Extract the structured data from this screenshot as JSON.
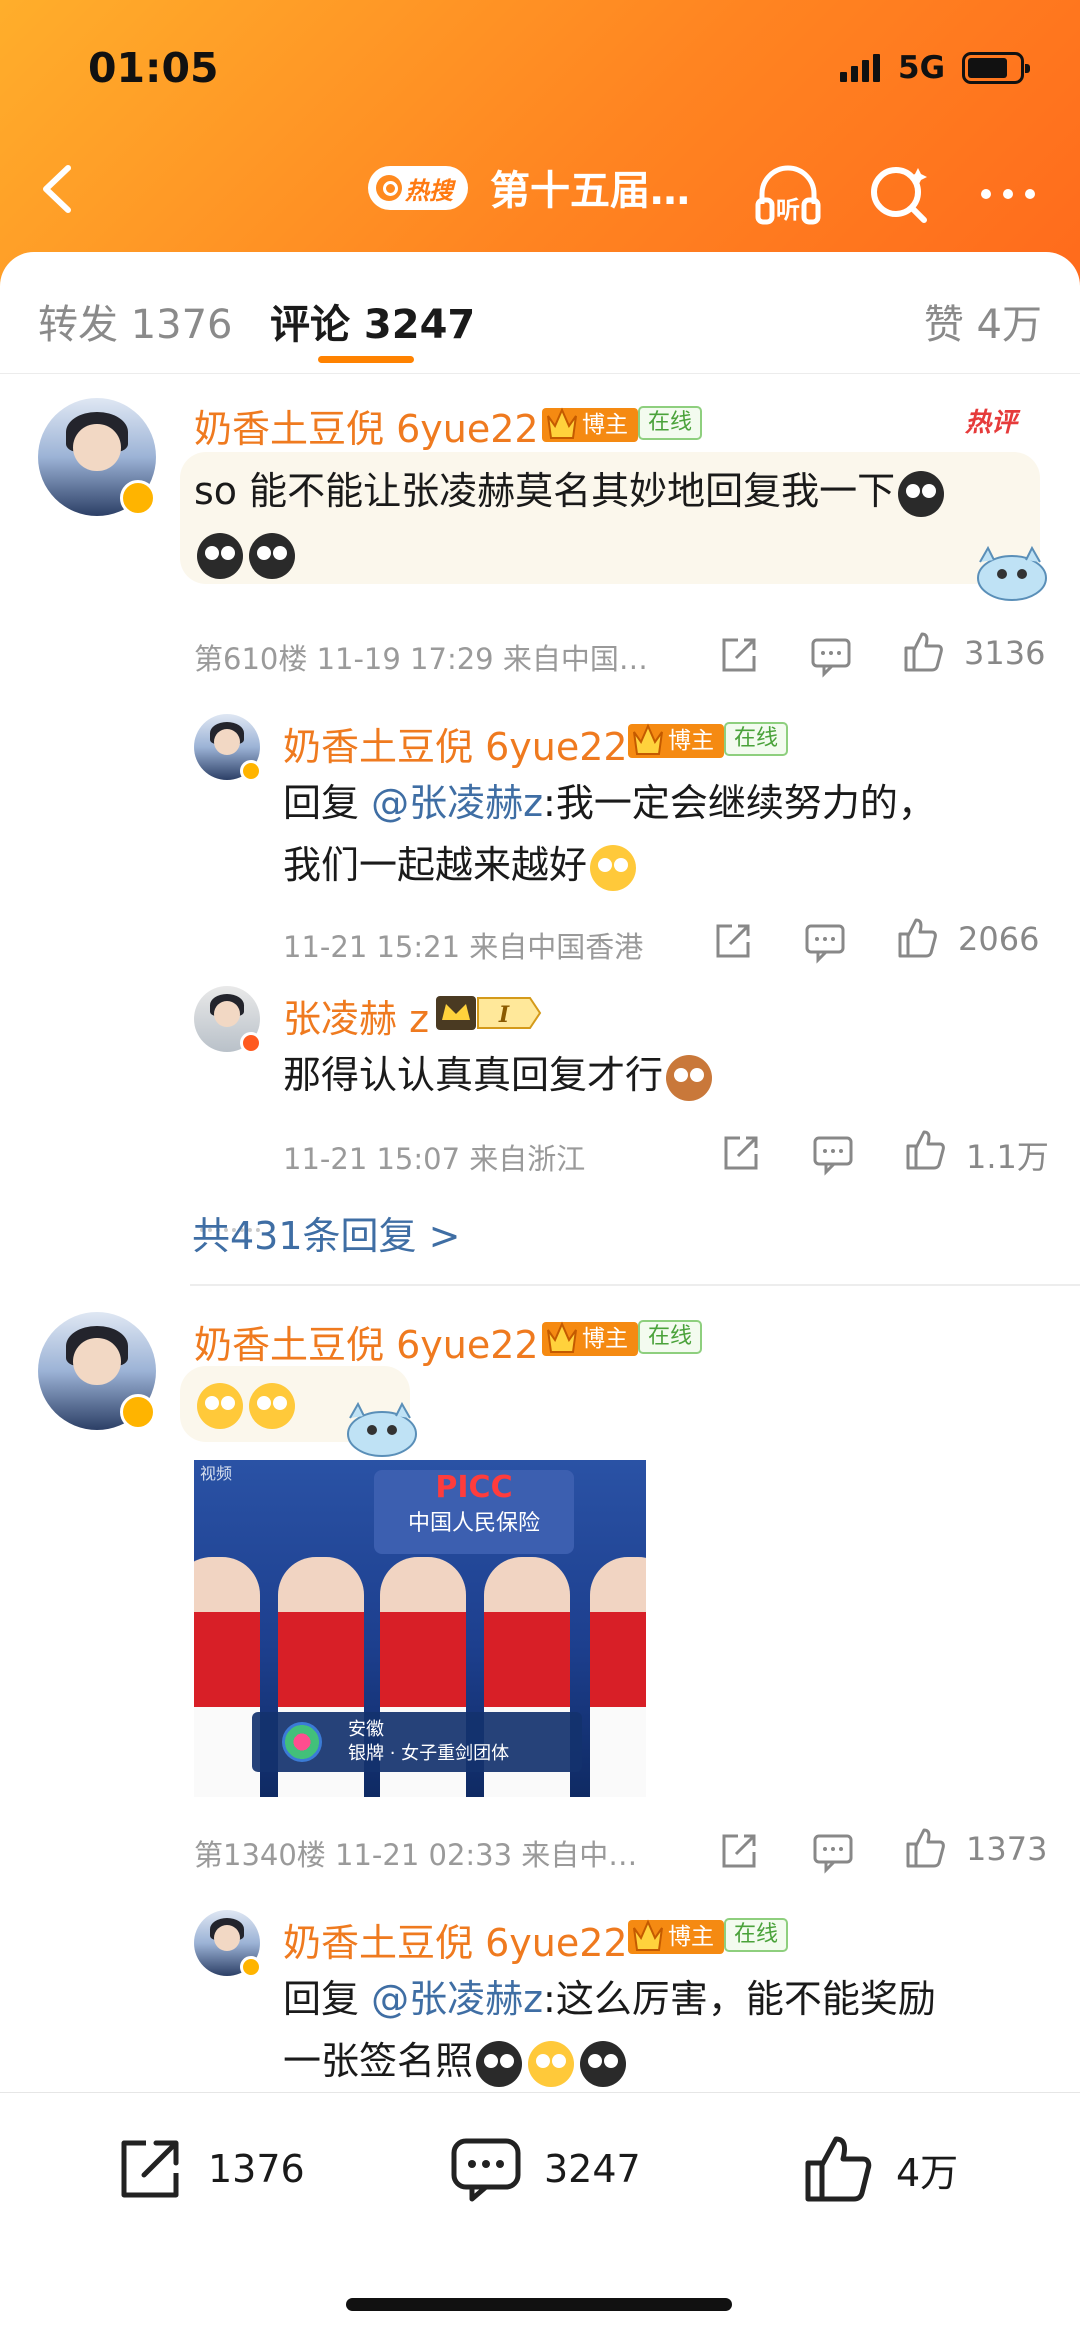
{
  "status": {
    "time": "01:05",
    "network": "5G"
  },
  "header": {
    "hot_label": "热搜",
    "title": "第十五届…"
  },
  "tabs": {
    "repost": "转发 1376",
    "comments": "评论 3247",
    "likes": "赞 4万"
  },
  "badges": {
    "blogger": "博主",
    "online": "在线",
    "hot_comment": "热评"
  },
  "comments": [
    {
      "user": "奶香土豆倪 6yue22",
      "text_line1": "so 能不能让张凌赫莫名其妙地回复我一下",
      "meta": "第610楼 11-19 17:29 来自中国…",
      "likes": "3136",
      "replies": [
        {
          "user": "奶香土豆倪 6yue22",
          "prefix": "回复 ",
          "mention": "@张凌赫z",
          "text1": ":我一定会继续努力的，",
          "text2": "我们一起越来越好",
          "meta": "11-21 15:21 来自中国香港",
          "likes": "2066"
        },
        {
          "user": "张凌赫 z",
          "text1": "那得认认真真回复才行",
          "meta": "11-21 15:07 来自浙江",
          "likes": "1.1万"
        }
      ],
      "more_replies": "共431条回复 >"
    },
    {
      "user": "奶香土豆倪 6yue22",
      "meta": "第1340楼 11-21 02:33 来自中…",
      "likes": "1373",
      "image": {
        "watermark": "视频",
        "sponsor": "PICC",
        "sponsor_sub": "中国人民保险",
        "team": "安徽",
        "caption": "银牌 · 女子重剑团体"
      },
      "replies": [
        {
          "user": "奶香土豆倪 6yue22",
          "prefix": "回复 ",
          "mention": "@张凌赫z",
          "text1": ":这么厉害，能不能奖励",
          "text2": "一张签名照"
        }
      ]
    }
  ],
  "bottom_bar": {
    "repost": "1376",
    "comment": "3247",
    "like": "4万"
  },
  "colors": {
    "accent": "#ff8200",
    "username": "#ef7a1f",
    "link": "#3f6ea4"
  }
}
